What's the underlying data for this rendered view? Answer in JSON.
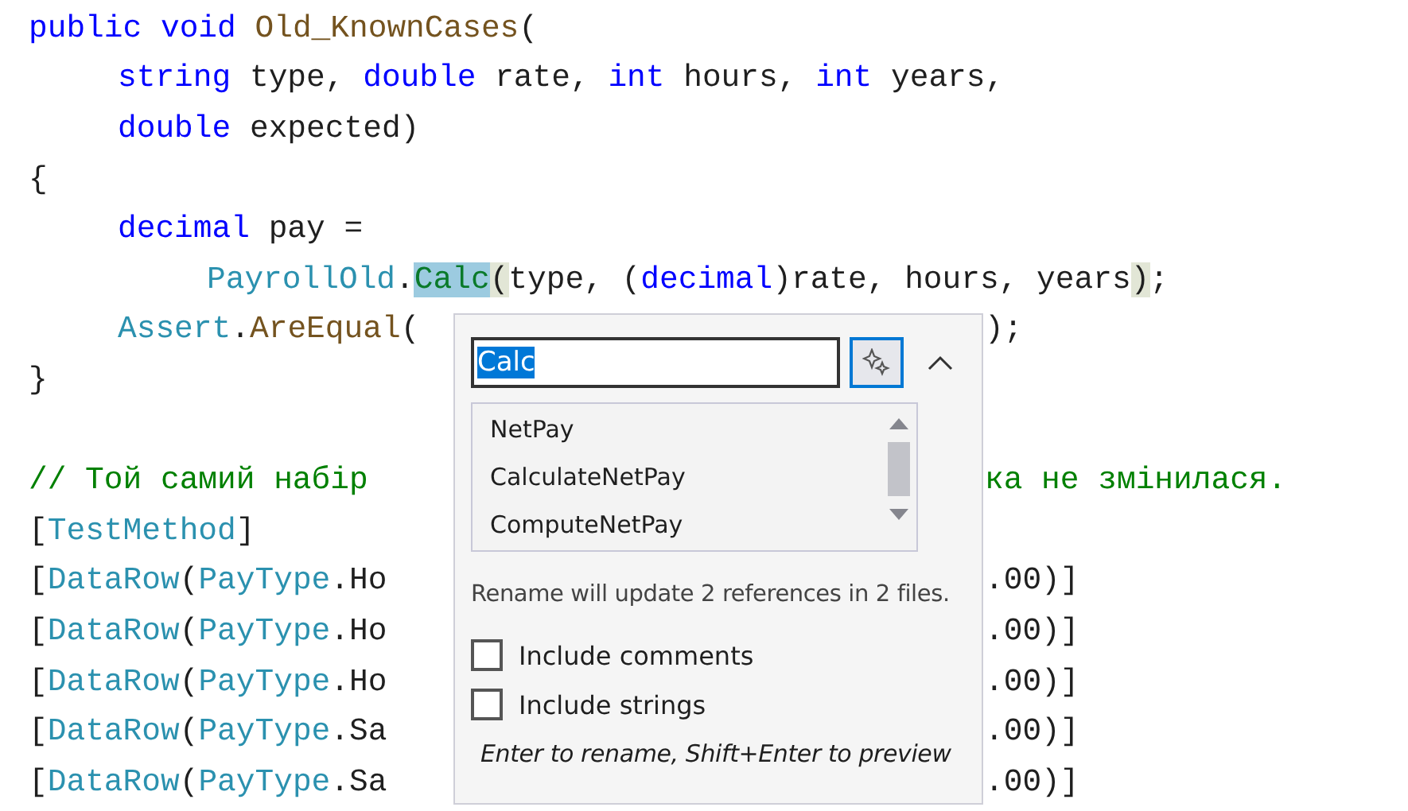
{
  "editor": {
    "lines": [
      {
        "kind": "code",
        "tokens": [
          {
            "kind": "keyword",
            "text": "public void "
          },
          {
            "kind": "method",
            "text": "Old_KnownCases"
          },
          {
            "kind": "plain",
            "text": "("
          }
        ],
        "children": [
          {
            "kind": "code",
            "tokens": [
              {
                "kind": "keyword",
                "text": "string"
              },
              {
                "kind": "plain",
                "text": " type, "
              },
              {
                "kind": "keyword",
                "text": "double"
              },
              {
                "kind": "plain",
                "text": " rate, "
              },
              {
                "kind": "keyword",
                "text": "int"
              },
              {
                "kind": "plain",
                "text": " hours, "
              },
              {
                "kind": "keyword",
                "text": "int"
              },
              {
                "kind": "plain",
                "text": " years,"
              }
            ]
          },
          {
            "kind": "code",
            "tokens": [
              {
                "kind": "keyword",
                "text": "double"
              },
              {
                "kind": "plain",
                "text": " expected)"
              }
            ]
          }
        ]
      },
      {
        "kind": "code",
        "tokens": [
          {
            "kind": "plain",
            "text": "{"
          }
        ],
        "children": [
          {
            "kind": "code",
            "tokens": [
              {
                "kind": "keyword",
                "text": "decimal"
              },
              {
                "kind": "plain",
                "text": " pay ="
              }
            ],
            "children": [
              {
                "kind": "code",
                "tokens": [
                  {
                    "kind": "type",
                    "text": "PayrollOld"
                  },
                  {
                    "kind": "plain",
                    "text": "."
                  },
                  {
                    "kind": "rename",
                    "text": "Calc"
                  },
                  {
                    "kind": "brace",
                    "text": "("
                  },
                  {
                    "kind": "plain",
                    "text": "type, ("
                  },
                  {
                    "kind": "keyword",
                    "text": "decimal"
                  },
                  {
                    "kind": "plain",
                    "text": ")rate, hours, years"
                  },
                  {
                    "kind": "brace",
                    "text": ")"
                  },
                  {
                    "kind": "plain",
                    "text": ";"
                  }
                ]
              }
            ]
          },
          {
            "kind": "code",
            "tokens": [
              {
                "kind": "type",
                "text": "Assert"
              },
              {
                "kind": "plain",
                "text": "."
              },
              {
                "kind": "method",
                "text": "AreEqual"
              },
              {
                "kind": "plain",
                "text": "("
              }
            ],
            "after_popup": [
              {
                "kind": "plain",
                "text": ");"
              }
            ]
          }
        ]
      },
      {
        "kind": "code",
        "tokens": [
          {
            "kind": "plain",
            "text": "}"
          }
        ]
      },
      {
        "kind": "blank"
      },
      {
        "kind": "code",
        "tokens": [
          {
            "kind": "comment",
            "text": "// Той самий набір"
          }
        ],
        "after_popup": [
          {
            "kind": "comment",
            "text": "ка не змінилася."
          }
        ]
      },
      {
        "kind": "code",
        "tokens": [
          {
            "kind": "plain",
            "text": "["
          },
          {
            "kind": "type",
            "text": "TestMethod"
          },
          {
            "kind": "plain",
            "text": "]"
          }
        ]
      },
      {
        "kind": "code",
        "tokens": [
          {
            "kind": "plain",
            "text": "["
          },
          {
            "kind": "type",
            "text": "DataRow"
          },
          {
            "kind": "plain",
            "text": "("
          },
          {
            "kind": "type",
            "text": "PayType"
          },
          {
            "kind": "plain",
            "text": ".Ho"
          }
        ],
        "after_popup": [
          {
            "kind": "plain",
            "text": ".00)]"
          }
        ]
      },
      {
        "kind": "code",
        "tokens": [
          {
            "kind": "plain",
            "text": "["
          },
          {
            "kind": "type",
            "text": "DataRow"
          },
          {
            "kind": "plain",
            "text": "("
          },
          {
            "kind": "type",
            "text": "PayType"
          },
          {
            "kind": "plain",
            "text": ".Ho"
          }
        ],
        "after_popup": [
          {
            "kind": "plain",
            "text": ".00)]"
          }
        ]
      },
      {
        "kind": "code",
        "tokens": [
          {
            "kind": "plain",
            "text": "["
          },
          {
            "kind": "type",
            "text": "DataRow"
          },
          {
            "kind": "plain",
            "text": "("
          },
          {
            "kind": "type",
            "text": "PayType"
          },
          {
            "kind": "plain",
            "text": ".Ho"
          }
        ],
        "after_popup": [
          {
            "kind": "plain",
            "text": ".00)]"
          }
        ]
      },
      {
        "kind": "code",
        "tokens": [
          {
            "kind": "plain",
            "text": "["
          },
          {
            "kind": "type",
            "text": "DataRow"
          },
          {
            "kind": "plain",
            "text": "("
          },
          {
            "kind": "type",
            "text": "PayType"
          },
          {
            "kind": "plain",
            "text": ".Sa"
          }
        ],
        "after_popup": [
          {
            "kind": "plain",
            "text": ".00)]"
          }
        ]
      },
      {
        "kind": "code",
        "tokens": [
          {
            "kind": "plain",
            "text": "["
          },
          {
            "kind": "type",
            "text": "DataRow"
          },
          {
            "kind": "plain",
            "text": "("
          },
          {
            "kind": "type",
            "text": "PayType"
          },
          {
            "kind": "plain",
            "text": ".Sa"
          }
        ],
        "after_popup": [
          {
            "kind": "plain",
            "text": ".00)]"
          }
        ]
      }
    ]
  },
  "rename_popup": {
    "value": "Calc",
    "value_selected": true,
    "suggestions": [
      {
        "label": "NetPay",
        "selected": false
      },
      {
        "label": "CalculateNetPay",
        "selected": false
      },
      {
        "label": "ComputeNetPay",
        "selected": false
      }
    ],
    "message": "Rename will update 2 references in 2 files.",
    "options": [
      {
        "label": "Include comments",
        "checked": false
      },
      {
        "label": "Include strings",
        "checked": false
      }
    ],
    "hint": "Enter to rename, Shift+Enter to preview"
  }
}
